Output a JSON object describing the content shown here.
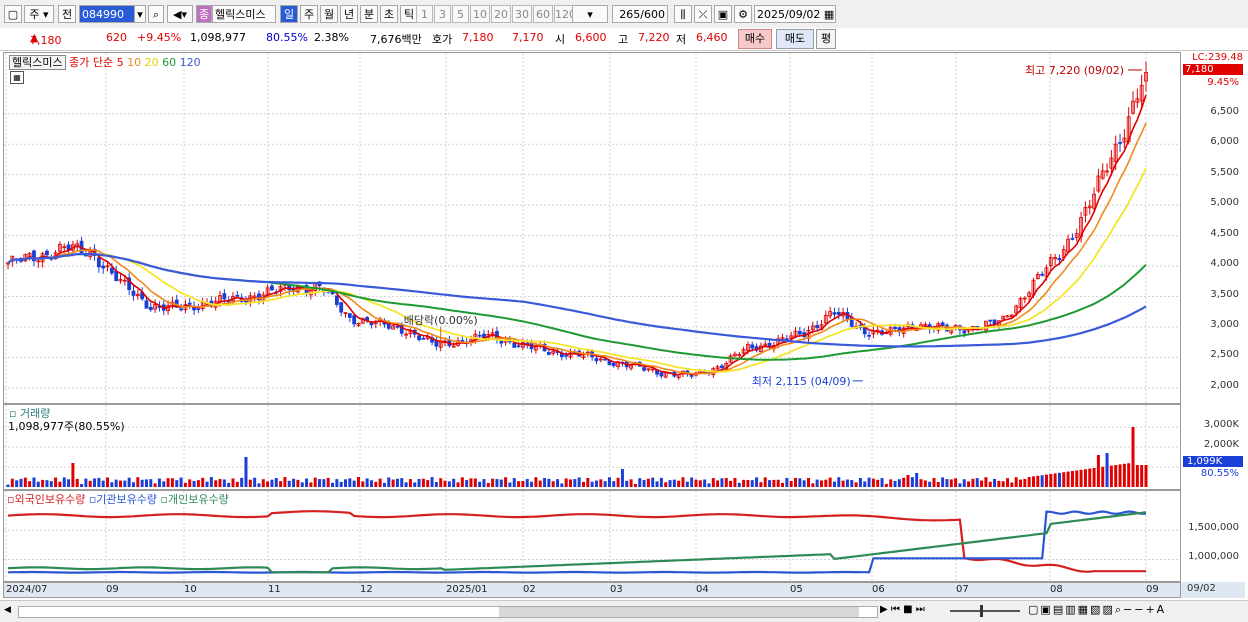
{
  "toolbar": {
    "market": "주",
    "prev_label": "전",
    "code": "084990",
    "stock_name": "헬릭스미스",
    "period_label": "종",
    "periods": [
      "일",
      "주",
      "월",
      "년",
      "분",
      "초",
      "틱"
    ],
    "minutes": [
      "1",
      "3",
      "5",
      "10",
      "20",
      "30",
      "60",
      "120"
    ],
    "count": "265",
    "count_total": "/600",
    "date": "2025/09/02"
  },
  "quote": {
    "price": "7,180",
    "change": "620",
    "change_pct": "+9.45%",
    "volume": "1,098,977",
    "volume_ratio": "80.55%",
    "turnover": "2.38%",
    "amount": "7,676백만",
    "ask_label": "호가",
    "ask_price": "7,180",
    "bid_price": "7,170",
    "open_label": "시",
    "open": "6,600",
    "high_label": "고",
    "high": "7,220",
    "low_label": "저",
    "low": "6,460",
    "buy_label": "매수",
    "sell_label": "매도",
    "avg_label": "평"
  },
  "colors": {
    "up": "#e00000",
    "down": "#1a3fd6",
    "ma5": "#e00000",
    "ma10": "#f08a1a",
    "ma20": "#f5e52a",
    "ma60": "#1f9a33",
    "ma120": "#3a5bd9",
    "foreign": "#d42020",
    "inst": "#2a56d4",
    "indiv": "#2e8a55"
  },
  "price_panel": {
    "legend_name": "헬릭스미스",
    "legend_ma": [
      "종가 단순",
      "5",
      "10",
      "20",
      "60",
      "120"
    ],
    "lc_label": "LC:239.48",
    "last_price": "7,180",
    "last_change": "9.45%",
    "high_note": "최고 7,220 (09/02)",
    "low_note": "최저 2,115 (04/09)",
    "dividend_note": "배당락(0.00%)"
  },
  "volume_panel": {
    "title": "거래량",
    "value": "1,098,977주(80.55%)",
    "last_tag": "1,099K",
    "last_ratio": "80.55%"
  },
  "holdings_panel": {
    "series_labels": [
      "외국인보유수량",
      "기관보유수량",
      "개인보유수량"
    ]
  },
  "chart_data": [
    {
      "type": "candlestick",
      "title": "헬릭스미스",
      "ylim": [
        1850,
        7400
      ],
      "y_ticks": [
        2000,
        2500,
        3000,
        3500,
        4000,
        4500,
        5000,
        5500,
        6000,
        6500
      ],
      "x_ticks": [
        "2024/07",
        "09",
        "10",
        "11",
        "12",
        "2025/01",
        "02",
        "03",
        "04",
        "05",
        "06",
        "07",
        "08",
        "09"
      ],
      "series_close": [
        [
          "2024/07",
          4050
        ],
        [
          "2024/07b",
          4150
        ],
        [
          "2024/07c",
          4300
        ],
        [
          "2024/08",
          4200
        ],
        [
          "2024/08b",
          3700
        ],
        [
          "2024/08c",
          3350
        ],
        [
          "2024/09",
          3300
        ],
        [
          "2024/09b",
          3400
        ],
        [
          "2024/10",
          3450
        ],
        [
          "2024/10b",
          3550
        ],
        [
          "2024/10c",
          3650
        ],
        [
          "2024/11",
          3650
        ],
        [
          "2024/11b",
          3150
        ],
        [
          "2024/11c",
          3050
        ],
        [
          "2024/12",
          2950
        ],
        [
          "2024/12b",
          2700
        ],
        [
          "2024/12c",
          2780
        ],
        [
          "2025/01",
          2850
        ],
        [
          "2025/01b",
          2700
        ],
        [
          "2025/02",
          2600
        ],
        [
          "2025/02b",
          2550
        ],
        [
          "2025/03",
          2450
        ],
        [
          "2025/03b",
          2350
        ],
        [
          "2025/04",
          2250
        ],
        [
          "2025/04b",
          2200
        ],
        [
          "2025/04c",
          2350
        ],
        [
          "2025/05",
          2650
        ],
        [
          "2025/05b",
          2750
        ],
        [
          "2025/05c",
          2900
        ],
        [
          "2025/06",
          3250
        ],
        [
          "2025/06b",
          2950
        ],
        [
          "2025/06c",
          2900
        ],
        [
          "2025/07",
          3050
        ],
        [
          "2025/07b",
          2950
        ],
        [
          "2025/07c",
          3000
        ],
        [
          "2025/08",
          3100
        ],
        [
          "2025/08b",
          3700
        ],
        [
          "2025/08c",
          4200
        ],
        [
          "2025/08d",
          5000
        ],
        [
          "2025/08e",
          6000
        ],
        [
          "2025/09",
          7180
        ]
      ],
      "high_point": {
        "date": "09/02",
        "value": 7220
      },
      "low_point": {
        "date": "04/09",
        "value": 2115
      }
    },
    {
      "type": "bar",
      "title": "거래량",
      "ylim": [
        0,
        3500
      ],
      "y_ticks_k": [
        1000,
        2000,
        3000
      ],
      "last_value_k": 1099
    },
    {
      "type": "line",
      "title": "보유수량",
      "y_ticks": [
        1000000,
        1500000
      ],
      "series": [
        {
          "name": "외국인보유수량"
        },
        {
          "name": "기관보유수량"
        },
        {
          "name": "개인보유수량"
        }
      ]
    }
  ],
  "axis": {
    "price_ticks": [
      "6,500",
      "6,000",
      "5,500",
      "5,000",
      "4,500",
      "4,000",
      "3,500",
      "3,000",
      "2,500",
      "2,000"
    ],
    "vol_ticks": [
      "3,000K",
      "2,000K"
    ],
    "hold_ticks": [
      "1,500,000",
      "1,000,000"
    ],
    "x_labels": [
      "2024/07",
      "09",
      "10",
      "11",
      "12",
      "2025/01",
      "02",
      "03",
      "04",
      "05",
      "06",
      "07",
      "08",
      "09"
    ],
    "x_current": "09/02"
  }
}
